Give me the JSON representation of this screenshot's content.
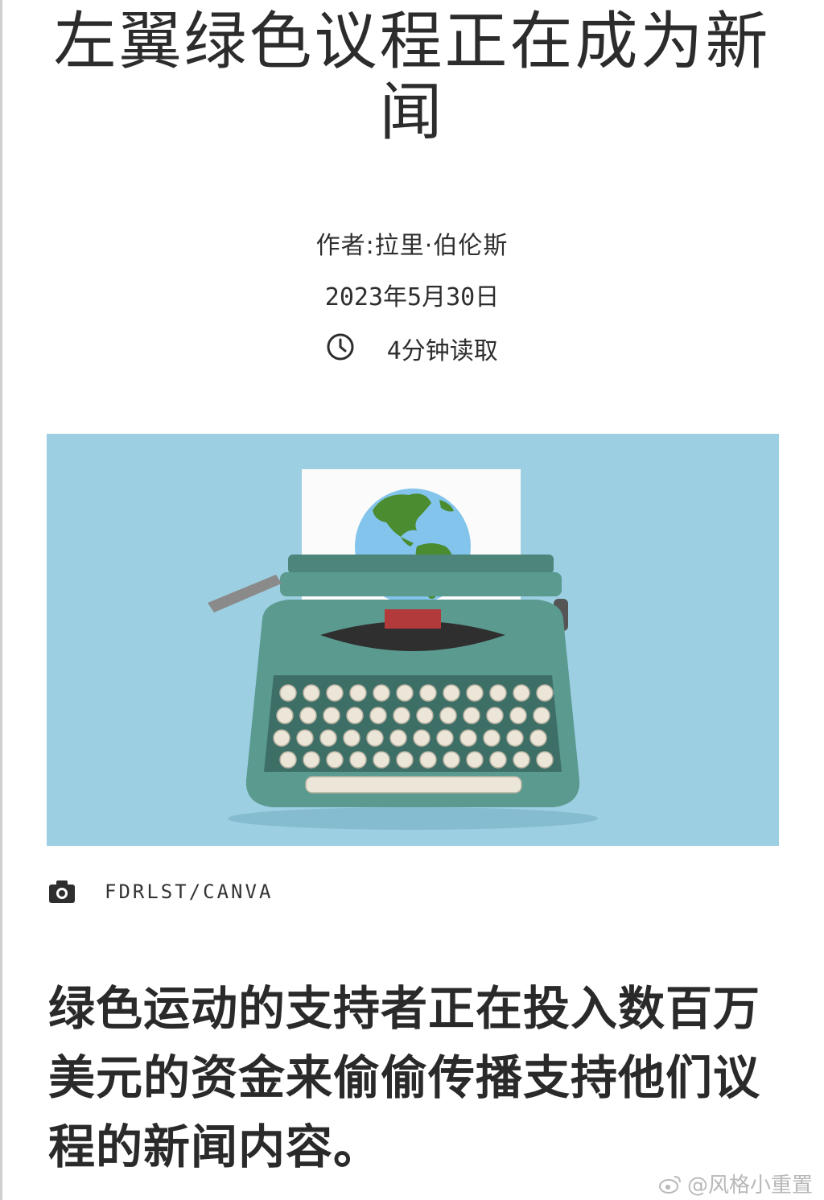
{
  "article": {
    "title": "左翼绿色议程正在成为新闻",
    "author": "作者:拉里·伯伦斯",
    "date": "2023年5月30日",
    "read_time": "4分钟读取",
    "image_credit": "FDRLST/CANVA",
    "lede": "绿色运动的支持者正在投入数百万美元的资金来偷偷传播支持他们议程的新闻内容。"
  },
  "watermark": {
    "text": "@风格小重置"
  },
  "icons": {
    "clock": "clock-icon",
    "camera": "camera-icon",
    "weibo": "weibo-icon"
  },
  "colors": {
    "hero_background": "#9dcfe2",
    "typewriter_body": "#5a9a8f",
    "globe_ocean": "#82c4ec",
    "globe_land": "#4a8c2f"
  }
}
